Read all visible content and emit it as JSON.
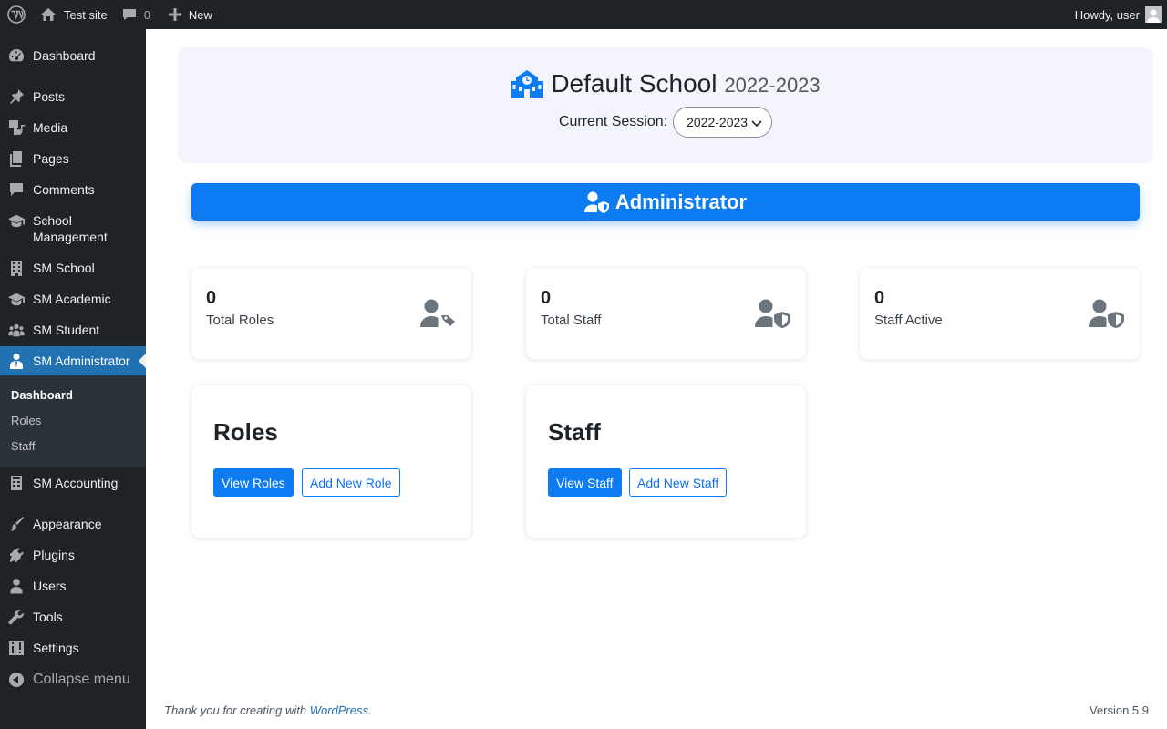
{
  "adminbar": {
    "site_name": "Test site",
    "comments_count": "0",
    "new_label": "New",
    "howdy": "Howdy, user"
  },
  "sidebar": {
    "items": [
      {
        "label": "Dashboard",
        "icon": "dashboard-icon"
      },
      {
        "label": "Posts",
        "icon": "pin-icon"
      },
      {
        "label": "Media",
        "icon": "media-icon"
      },
      {
        "label": "Pages",
        "icon": "pages-icon"
      },
      {
        "label": "Comments",
        "icon": "comment-icon"
      },
      {
        "label": "School Management",
        "icon": "graduation-cap-icon"
      },
      {
        "label": "SM School",
        "icon": "building-icon"
      },
      {
        "label": "SM Academic",
        "icon": "graduation-cap-icon"
      },
      {
        "label": "SM Student",
        "icon": "groups-icon"
      },
      {
        "label": "SM Administrator",
        "icon": "businessman-icon"
      },
      {
        "label": "SM Accounting",
        "icon": "spreadsheet-icon"
      },
      {
        "label": "Appearance",
        "icon": "brush-icon"
      },
      {
        "label": "Plugins",
        "icon": "plugin-icon"
      },
      {
        "label": "Users",
        "icon": "user-icon"
      },
      {
        "label": "Tools",
        "icon": "wrench-icon"
      },
      {
        "label": "Settings",
        "icon": "settings-icon"
      }
    ],
    "submenu": [
      "Dashboard",
      "Roles",
      "Staff"
    ],
    "collapse_label": "Collapse menu"
  },
  "header": {
    "school_name": "Default School",
    "session_year": "2022-2023",
    "current_session_label": "Current Session:",
    "session_selected": "2022-2023"
  },
  "banner": {
    "title": "Administrator"
  },
  "stats": [
    {
      "value": "0",
      "label": "Total Roles",
      "icon": "user-tag-icon"
    },
    {
      "value": "0",
      "label": "Total Staff",
      "icon": "user-shield-icon"
    },
    {
      "value": "0",
      "label": "Staff Active",
      "icon": "user-shield-icon"
    }
  ],
  "panels": {
    "roles": {
      "title": "Roles",
      "view": "View Roles",
      "add": "Add New Role"
    },
    "staff": {
      "title": "Staff",
      "view": "View Staff",
      "add": "Add New Staff"
    }
  },
  "footer": {
    "thanks_prefix": "Thank you for creating with ",
    "wordpress_link": "WordPress",
    "thanks_suffix": ".",
    "version": "Version 5.9"
  },
  "colors": {
    "primary": "#0d7cf2",
    "admin_dark": "#1d2327",
    "menu_current": "#2271b1"
  }
}
